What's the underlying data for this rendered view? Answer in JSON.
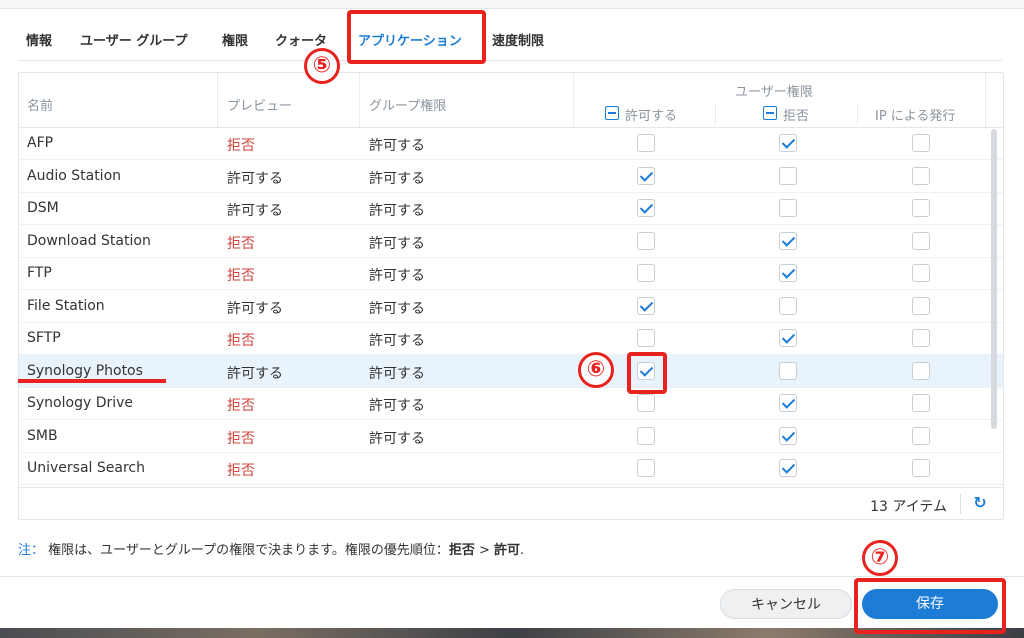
{
  "tabs": [
    {
      "label": "情報"
    },
    {
      "label": "ユーザー グループ"
    },
    {
      "label": "権限"
    },
    {
      "label": "クォータ"
    },
    {
      "label": "アプリケーション",
      "active": true
    },
    {
      "label": "速度制限"
    }
  ],
  "table": {
    "columns": {
      "name": "名前",
      "preview": "プレビュー",
      "group": "グループ権限",
      "user_perm": "ユーザー権限",
      "allow": "許可する",
      "deny": "拒否",
      "ip": "IP による発行"
    },
    "rows": [
      {
        "name": "AFP",
        "preview": "拒否",
        "group": "許可する",
        "allow": false,
        "deny": true,
        "ip": false
      },
      {
        "name": "Audio Station",
        "preview": "許可する",
        "group": "許可する",
        "allow": true,
        "deny": false,
        "ip": false
      },
      {
        "name": "DSM",
        "preview": "許可する",
        "group": "許可する",
        "allow": true,
        "deny": false,
        "ip": false
      },
      {
        "name": "Download Station",
        "preview": "拒否",
        "group": "許可する",
        "allow": false,
        "deny": true,
        "ip": false
      },
      {
        "name": "FTP",
        "preview": "拒否",
        "group": "許可する",
        "allow": false,
        "deny": true,
        "ip": false
      },
      {
        "name": "File Station",
        "preview": "許可する",
        "group": "許可する",
        "allow": true,
        "deny": false,
        "ip": false
      },
      {
        "name": "SFTP",
        "preview": "拒否",
        "group": "許可する",
        "allow": false,
        "deny": true,
        "ip": false
      },
      {
        "name": "Synology Photos",
        "preview": "許可する",
        "group": "許可する",
        "allow": true,
        "deny": false,
        "ip": false,
        "selected": true
      },
      {
        "name": "Synology Drive",
        "preview": "拒否",
        "group": "許可する",
        "allow": false,
        "deny": true,
        "ip": false
      },
      {
        "name": "SMB",
        "preview": "拒否",
        "group": "許可する",
        "allow": false,
        "deny": true,
        "ip": false
      },
      {
        "name": "Universal Search",
        "preview": "拒否",
        "group": "",
        "allow": false,
        "deny": true,
        "ip": false
      }
    ],
    "count": "13 アイテム"
  },
  "note": {
    "label": "注：",
    "text": "権限は、ユーザーとグループの権限で決まります。権限の優先順位：",
    "deny": "拒否",
    "gt": " > ",
    "allow": "許可",
    "end": "."
  },
  "buttons": {
    "cancel": "キャンセル",
    "save": "保存"
  },
  "annotations": {
    "five": "⑤",
    "six": "⑥",
    "seven": "⑦"
  },
  "colors": {
    "accent": "#1d7dd6",
    "deny": "#d0463c",
    "annotation": "#e8231f"
  },
  "icons": {
    "refresh": "refresh-icon",
    "check": "check-icon",
    "minus": "minus-icon"
  }
}
